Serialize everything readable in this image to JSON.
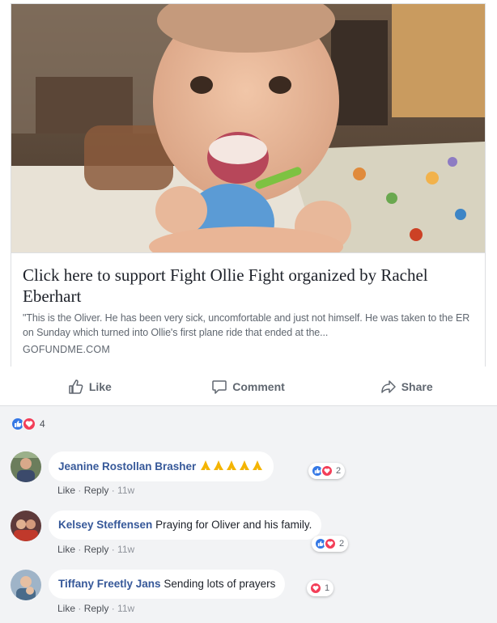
{
  "link_card": {
    "title": "Click here to support Fight Ollie Fight organized by Rachel Eberhart",
    "description": "\"This is the Oliver. He has been very sick, uncomfortable and just not himself. He was taken to the ER on Sunday which turned into Ollie's first plane ride that ended at the...",
    "domain": "GOFUNDME.COM"
  },
  "actions": {
    "like": "Like",
    "comment": "Comment",
    "share": "Share"
  },
  "reactions_summary": {
    "count": "4",
    "icons": [
      "like-reaction-icon",
      "love-reaction-icon"
    ],
    "like_color": "#3578e5",
    "love_color": "#f33e58"
  },
  "comments": [
    {
      "author": "Jeanine Rostollan Brasher",
      "text": "",
      "emoji": "🙏🙏🙏🙏🙏",
      "reaction_count": "2",
      "reactions": [
        "like",
        "love"
      ],
      "meta": {
        "like": "Like",
        "reply": "Reply",
        "time": "11w"
      }
    },
    {
      "author": "Kelsey Steffensen",
      "text": "Praying for Oliver and his family.",
      "reaction_count": "2",
      "reactions": [
        "like",
        "love"
      ],
      "meta": {
        "like": "Like",
        "reply": "Reply",
        "time": "11w"
      }
    },
    {
      "author": "Tiffany Freetly Jans",
      "text": "Sending lots of prayers",
      "reaction_count": "1",
      "reactions": [
        "love"
      ],
      "meta": {
        "like": "Like",
        "reply": "Reply",
        "time": "11w"
      }
    }
  ],
  "colors": {
    "link_blue": "#365899",
    "muted_text": "#606770",
    "gray_background": "#f2f3f5"
  }
}
